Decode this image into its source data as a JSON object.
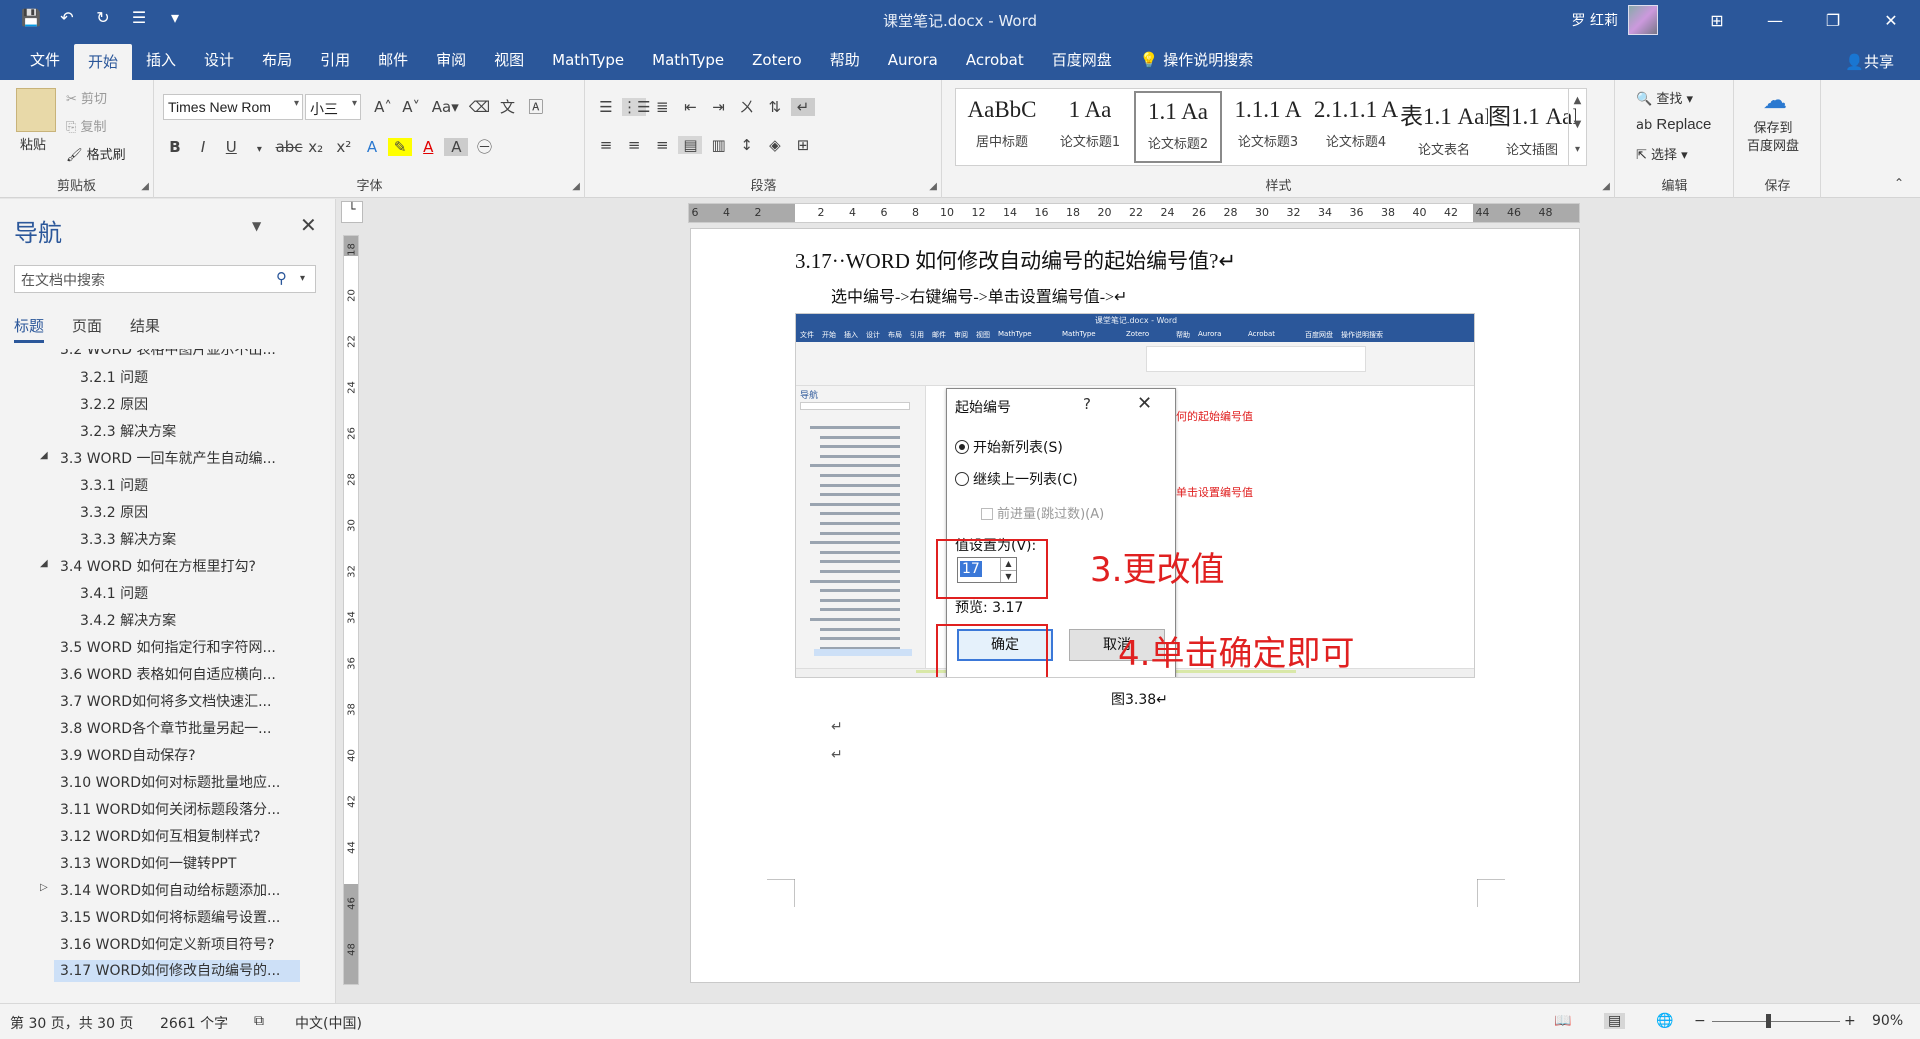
{
  "titlebar": {
    "title": "课堂笔记.docx - Word",
    "user": "罗 红莉",
    "qat": [
      "save-icon",
      "undo-icon",
      "redo-icon",
      "touch-mode-icon",
      "customize-icon"
    ],
    "minimize": "—",
    "restore": "❐",
    "close": "✕",
    "ribbon_display": "⊞"
  },
  "tabs": [
    "文件",
    "开始",
    "插入",
    "设计",
    "布局",
    "引用",
    "邮件",
    "审阅",
    "视图",
    "MathType",
    "MathType",
    "Zotero",
    "帮助",
    "Aurora",
    "Acrobat",
    "百度网盘",
    "操作说明搜索"
  ],
  "share": "共享",
  "ribbon": {
    "clipboard": {
      "label": "剪贴板",
      "paste": "粘贴",
      "cut": "剪切",
      "copy": "复制",
      "format_painter": "格式刷"
    },
    "font": {
      "label": "字体",
      "font_name": "Times New Rom",
      "font_size": "小三"
    },
    "paragraph": {
      "label": "段落"
    },
    "styles": {
      "label": "样式",
      "items": [
        {
          "preview": "AaBbC",
          "name": "居中标题"
        },
        {
          "preview": "1 Aa",
          "name": "论文标题1"
        },
        {
          "preview": "1.1 Aa",
          "name": "论文标题2"
        },
        {
          "preview": "1.1.1 A",
          "name": "论文标题3"
        },
        {
          "preview": "2.1.1.1 A",
          "name": "论文标题4"
        },
        {
          "preview": "表1.1 AaI",
          "name": "论文表名"
        },
        {
          "preview": "图1.1 AaI",
          "name": "论文插图"
        }
      ]
    },
    "editing": {
      "label": "编辑",
      "find": "查找",
      "replace": "Replace",
      "select": "选择"
    },
    "save": {
      "label": "保存",
      "button": "保存到\n百度网盘",
      "line1": "保存到",
      "line2": "百度网盘"
    }
  },
  "nav": {
    "title": "导航",
    "search_placeholder": "在文档中搜索",
    "tabs": [
      "标题",
      "页面",
      "结果"
    ],
    "items": [
      {
        "text": "3.2  WORD 表格中图片显示不出...",
        "level": 1
      },
      {
        "text": "3.2.1  问题",
        "level": 2
      },
      {
        "text": "3.2.2  原因",
        "level": 2
      },
      {
        "text": "3.2.3  解决方案",
        "level": 2
      },
      {
        "text": "3.3  WORD 一回车就产生自动编...",
        "level": 1
      },
      {
        "text": "3.3.1  问题",
        "level": 2
      },
      {
        "text": "3.3.2  原因",
        "level": 2
      },
      {
        "text": "3.3.3  解决方案",
        "level": 2
      },
      {
        "text": "3.4  WORD 如何在方框里打勾?",
        "level": 1
      },
      {
        "text": "3.4.1  问题",
        "level": 2
      },
      {
        "text": "3.4.2  解决方案",
        "level": 2
      },
      {
        "text": "3.5  WORD 如何指定行和字符网...",
        "level": 1
      },
      {
        "text": "3.6  WORD 表格如何自适应横向...",
        "level": 1
      },
      {
        "text": "3.7  WORD如何将多文档快速汇...",
        "level": 1
      },
      {
        "text": "3.8  WORD各个章节批量另起一...",
        "level": 1
      },
      {
        "text": "3.9  WORD自动保存?",
        "level": 1
      },
      {
        "text": "3.10  WORD如何对标题批量地应...",
        "level": 1
      },
      {
        "text": "3.11  WORD如何关闭标题段落分...",
        "level": 1
      },
      {
        "text": "3.12  WORD如何互相复制样式?",
        "level": 1
      },
      {
        "text": "3.13  WORD如何一键转PPT",
        "level": 1
      },
      {
        "text": "3.14  WORD如何自动给标题添加...",
        "level": 1
      },
      {
        "text": "3.15  WORD如何将标题编号设置...",
        "level": 1
      },
      {
        "text": "3.16  WORD如何定义新项目符号?",
        "level": 1
      },
      {
        "text": "3.17  WORD如何修改自动编号的...",
        "level": 1
      }
    ]
  },
  "hruler_numbers": [
    "6",
    "4",
    "2",
    "",
    "2",
    "4",
    "6",
    "8",
    "10",
    "12",
    "14",
    "16",
    "18",
    "20",
    "22",
    "24",
    "26",
    "28",
    "30",
    "32",
    "34",
    "36",
    "38",
    "40",
    "42",
    "44",
    "46",
    "48"
  ],
  "vruler_numbers": [
    "18",
    "20",
    "22",
    "24",
    "26",
    "28",
    "30",
    "32",
    "34",
    "36",
    "38",
    "40",
    "42",
    "44",
    "46",
    "48"
  ],
  "document": {
    "heading": "3.17··WORD 如何修改自动编号的起始编号值?↵",
    "para": "选中编号->右键编号->单击设置编号值->↵",
    "caption": "图3.38↵",
    "para_mark": "↵"
  },
  "screenshot": {
    "title": "课堂笔记.docx - Word",
    "tabs": [
      "文件",
      "开始",
      "插入",
      "设计",
      "布局",
      "引用",
      "邮件",
      "审阅",
      "视图",
      "MathType",
      "MathType",
      "Zotero",
      "帮助",
      "Aurora",
      "Acrobat",
      "百度网盘",
      "操作说明搜索"
    ],
    "nav_title": "导航",
    "dialog": {
      "title": "起始编号",
      "help": "?",
      "close": "✕",
      "opt1": "开始新列表(S)",
      "opt2": "继续上一列表(C)",
      "opt3": "前进量(跳过数)(A)",
      "value_label": "值设置为(V):",
      "value": "17",
      "preview": "预览: 3.17",
      "ok": "确定",
      "cancel": "取消"
    },
    "annotation_step3": "3.更改值",
    "annotation_step4": "4.单击确定即可",
    "annotation_small1": "单击设置编号值",
    "annotation_small2": "何的起始编号值"
  },
  "status": {
    "page": "第 30 页，共 30 页",
    "words": "2661 个字",
    "language": "中文(中国)",
    "zoom": "90%"
  },
  "colors": {
    "accent": "#2b579a",
    "annotation": "#e02020"
  }
}
